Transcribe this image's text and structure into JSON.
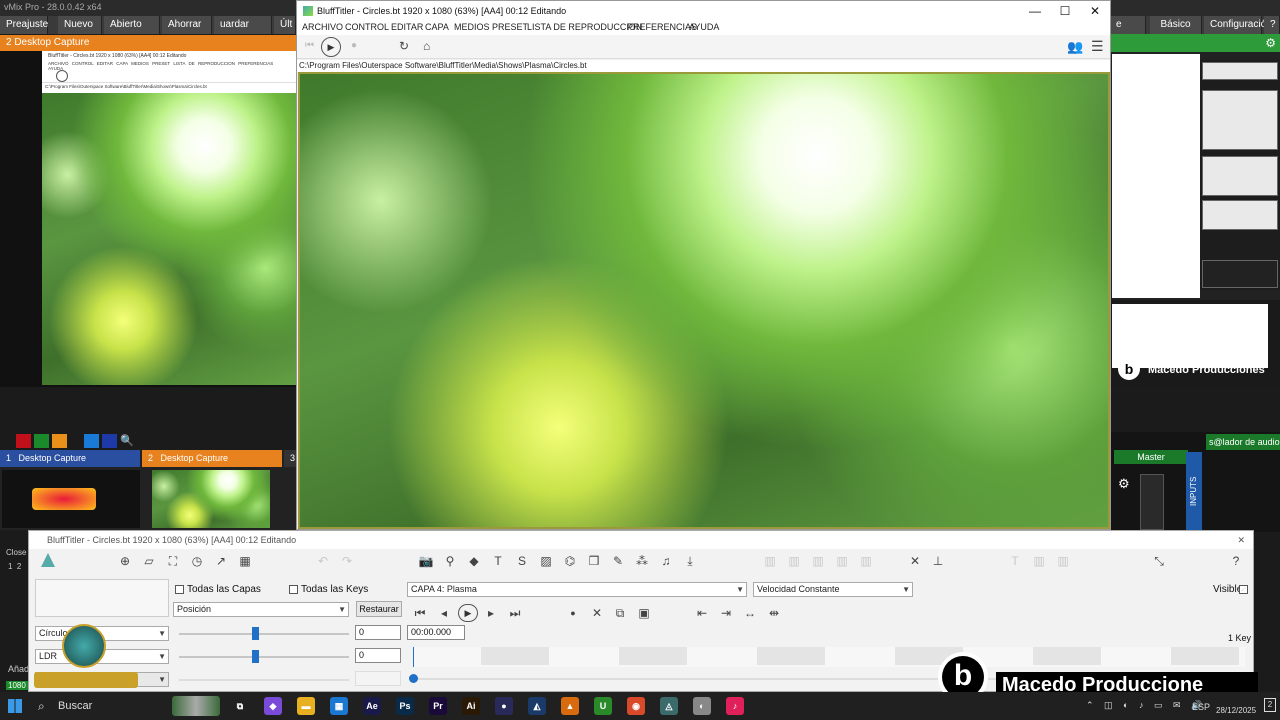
{
  "vmix": {
    "title": "vMix Pro - 28.0.0.42 x64",
    "menu": [
      "Preajuste",
      "Nuevo",
      "Abierto",
      "Ahorrar",
      "uardar com",
      "Últ"
    ],
    "right_menu": [
      "e pag",
      "Básico",
      "Configuración",
      "?"
    ],
    "left_header": "2   Desktop Capture",
    "inputs": [
      {
        "num": "1",
        "label": "Desktop Capture",
        "color": "#2a4fa0"
      },
      {
        "num": "2",
        "label": "Desktop Capture",
        "color": "#e8821e"
      },
      {
        "num": "3",
        "label": "",
        "color": "#333"
      }
    ],
    "close_label": "Close",
    "nums": "1  2",
    "add_label": "Añad",
    "res_label": "1080",
    "audio_header": "s@lador de audio",
    "master": "Master",
    "inputs_vertical": "INPUTS",
    "right_overlay": "Macedo Producciones",
    "right_small_label": "Macedo Producciones",
    "swatch_colors": [
      "#c0101a",
      "#1a8a2a",
      "#e8901a",
      "#1a7ad8",
      "#1e3aa8"
    ]
  },
  "mini": {
    "title": "BluffTitler - Circles.bt 1920 x 1080 (63%) [AA4] 00:12 Editando",
    "menu": "ARCHIVO CONTROL EDITAR CAPA MEDIOS PRESET LISTA DE REPRODUCCION PREFERENCIAS AYUDA",
    "path": "C:\\Program Files\\Outerspace Software\\BluffTitler\\Media\\Shows\\Plasma\\Circles.bt"
  },
  "bluff": {
    "title": "BluffTitler - Circles.bt 1920 x 1080 (63%) [AA4] 00:12 Editando",
    "menu": [
      "ARCHIVO",
      "CONTROL",
      "EDITAR",
      "CAPA",
      "MEDIOS",
      "PRESET",
      "LISTA DE REPRODUCCION",
      "PREFERENCIAS",
      "AYUDA"
    ],
    "path": "C:\\Program Files\\Outerspace Software\\BluffTitler\\Media\\Shows\\Plasma\\Circles.bt",
    "minimize": "—",
    "maximize": "☐",
    "close": "✕"
  },
  "editor": {
    "title": "BluffTitler - Circles.bt 1920 x 1080 (63%) [AA4] 00:12 Editando",
    "all_layers": "Todas las Capas",
    "all_keys": "Todas las Keys",
    "layer_select": "CAPA 4: Plasma",
    "speed_select": "Velocidad Constante",
    "visible": "Visible",
    "property_select": "Posición",
    "restore": "Restaurar",
    "param1": "Círculos",
    "param2": "LDR",
    "value1": "0",
    "value2": "0",
    "time": "00:00.000",
    "keys": "1 Key",
    "slider1": 0.43,
    "slider2": 0.43,
    "close": "✕"
  },
  "taskbar": {
    "search": "Buscar",
    "lang": "ESP",
    "date": "28/12/2025",
    "badge": "2",
    "apps": [
      {
        "name": "task-view",
        "label": "⧉",
        "color": "#202020"
      },
      {
        "name": "copilot",
        "label": "◆",
        "color": "#7a4ad8"
      },
      {
        "name": "file-explorer",
        "label": "▬",
        "color": "#e8b020"
      },
      {
        "name": "store",
        "label": "▦",
        "color": "#1a78d0"
      },
      {
        "name": "after-effects",
        "label": "Ae",
        "color": "#1a1a4a"
      },
      {
        "name": "photoshop",
        "label": "Ps",
        "color": "#0a2a4a"
      },
      {
        "name": "premiere",
        "label": "Pr",
        "color": "#1a0a3a"
      },
      {
        "name": "illustrator",
        "label": "Ai",
        "color": "#2a1a05"
      },
      {
        "name": "obs",
        "label": "●",
        "color": "#2a2a5a"
      },
      {
        "name": "app-a",
        "label": "◭",
        "color": "#1a3a6a"
      },
      {
        "name": "vlc",
        "label": "▲",
        "color": "#d86a10"
      },
      {
        "name": "app-u",
        "label": "U",
        "color": "#2a8a2a"
      },
      {
        "name": "chrome",
        "label": "◉",
        "color": "#d84a2a"
      },
      {
        "name": "blufftitler",
        "label": "◬",
        "color": "#3a6a6a"
      },
      {
        "name": "app-w",
        "label": "◐",
        "color": "#888"
      },
      {
        "name": "tiktok",
        "label": "♪",
        "color": "#e0205a"
      }
    ]
  },
  "overlay": {
    "logo_letter": "b",
    "text": "Macedo Produccione"
  }
}
